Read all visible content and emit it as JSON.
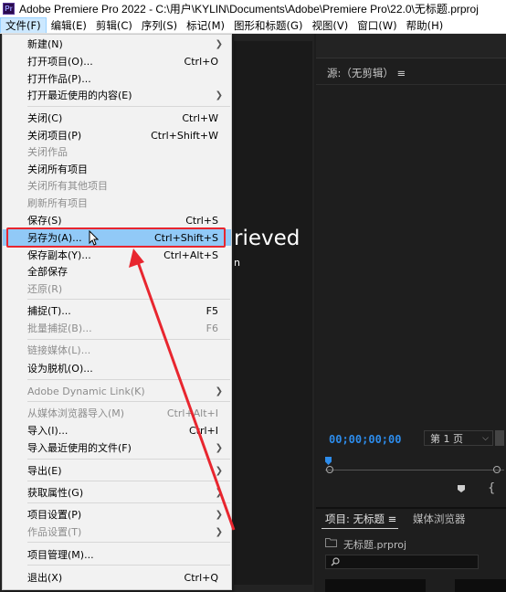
{
  "titlebar": {
    "app_icon": "Pr",
    "title": "Adobe Premiere Pro 2022 - C:\\用户\\KYLIN\\Documents\\Adobe\\Premiere Pro\\22.0\\无标题.prproj"
  },
  "menubar": {
    "items": [
      "文件(F)",
      "编辑(E)",
      "剪辑(C)",
      "序列(S)",
      "标记(M)",
      "图形和标题(G)",
      "视图(V)",
      "窗口(W)",
      "帮助(H)"
    ]
  },
  "file_menu": {
    "items": [
      {
        "label": "新建(N)",
        "shortcut": "",
        "submenu": true,
        "enabled": true
      },
      {
        "label": "打开项目(O)...",
        "shortcut": "Ctrl+O",
        "submenu": false,
        "enabled": true
      },
      {
        "label": "打开作品(P)...",
        "shortcut": "",
        "submenu": false,
        "enabled": true
      },
      {
        "label": "打开最近使用的内容(E)",
        "shortcut": "",
        "submenu": true,
        "enabled": true
      },
      {
        "label": "关闭(C)",
        "shortcut": "Ctrl+W",
        "submenu": false,
        "enabled": true
      },
      {
        "label": "关闭项目(P)",
        "shortcut": "Ctrl+Shift+W",
        "submenu": false,
        "enabled": true
      },
      {
        "label": "关闭作品",
        "shortcut": "",
        "submenu": false,
        "enabled": false
      },
      {
        "label": "关闭所有项目",
        "shortcut": "",
        "submenu": false,
        "enabled": true
      },
      {
        "label": "关闭所有其他项目",
        "shortcut": "",
        "submenu": false,
        "enabled": false
      },
      {
        "label": "刷新所有项目",
        "shortcut": "",
        "submenu": false,
        "enabled": false
      },
      {
        "label": "保存(S)",
        "shortcut": "Ctrl+S",
        "submenu": false,
        "enabled": true
      },
      {
        "label": "另存为(A)...",
        "shortcut": "Ctrl+Shift+S",
        "submenu": false,
        "enabled": true,
        "highlighted": true
      },
      {
        "label": "保存副本(Y)...",
        "shortcut": "Ctrl+Alt+S",
        "submenu": false,
        "enabled": true
      },
      {
        "label": "全部保存",
        "shortcut": "",
        "submenu": false,
        "enabled": true
      },
      {
        "label": "还原(R)",
        "shortcut": "",
        "submenu": false,
        "enabled": false
      },
      {
        "label": "捕捉(T)...",
        "shortcut": "F5",
        "submenu": false,
        "enabled": true
      },
      {
        "label": "批量捕捉(B)...",
        "shortcut": "F6",
        "submenu": false,
        "enabled": false
      },
      {
        "label": "链接媒体(L)...",
        "shortcut": "",
        "submenu": false,
        "enabled": false
      },
      {
        "label": "设为脱机(O)...",
        "shortcut": "",
        "submenu": false,
        "enabled": true
      },
      {
        "label": "Adobe Dynamic Link(K)",
        "shortcut": "",
        "submenu": true,
        "enabled": false
      },
      {
        "label": "从媒体浏览器导入(M)",
        "shortcut": "Ctrl+Alt+I",
        "submenu": false,
        "enabled": false
      },
      {
        "label": "导入(I)...",
        "shortcut": "Ctrl+I",
        "submenu": false,
        "enabled": true
      },
      {
        "label": "导入最近使用的文件(F)",
        "shortcut": "",
        "submenu": true,
        "enabled": true
      },
      {
        "label": "导出(E)",
        "shortcut": "",
        "submenu": true,
        "enabled": true
      },
      {
        "label": "获取属性(G)",
        "shortcut": "",
        "submenu": true,
        "enabled": true
      },
      {
        "label": "项目设置(P)",
        "shortcut": "",
        "submenu": true,
        "enabled": true
      },
      {
        "label": "作品设置(T)",
        "shortcut": "",
        "submenu": true,
        "enabled": false
      },
      {
        "label": "项目管理(M)...",
        "shortcut": "",
        "submenu": false,
        "enabled": true
      },
      {
        "label": "退出(X)",
        "shortcut": "Ctrl+Q",
        "submenu": false,
        "enabled": true
      }
    ]
  },
  "background": {
    "welcome_text": "rieved",
    "welcome_sub": "n",
    "source_tab": "源:（无剪辑）  ≡",
    "timecode": "00;00;00;00",
    "page_select": "第 1 页",
    "project_tab": "项目: 无标题  ≡",
    "media_tab": "媒体浏览器",
    "project_file": "无标题.prproj"
  },
  "colors": {
    "menu_bg": "#f2f2f2",
    "highlight": "#91c9f7",
    "annotation": "#e8262f",
    "timecode": "#2d8ceb"
  }
}
